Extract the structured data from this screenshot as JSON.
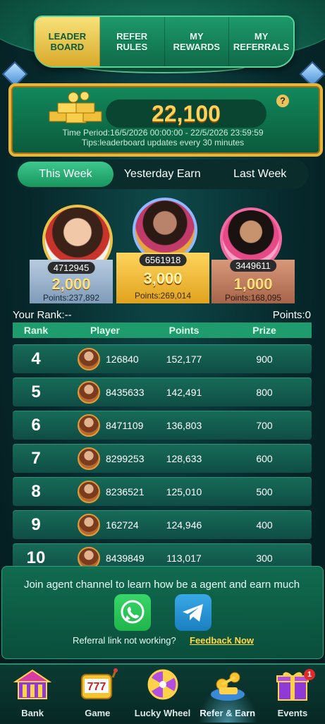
{
  "tabs": [
    {
      "label": "LEADER\nBOARD",
      "active": true
    },
    {
      "label": "REFER\nRULES",
      "active": false
    },
    {
      "label": "MY\nREWARDS",
      "active": false
    },
    {
      "label": "MY\nREFERRALS",
      "active": false
    }
  ],
  "prize_pool": {
    "amount": "22,100",
    "help_icon": "?",
    "time_period": "Time Period:16/5/2026 00:00:00 - 22/5/2026 23:59:59",
    "tips": "Tips:leaderboard updates every 30 minutes"
  },
  "week_tabs": [
    {
      "label": "This Week",
      "active": true
    },
    {
      "label": "Yesterday Earn",
      "active": false
    },
    {
      "label": "Last Week",
      "active": false
    }
  ],
  "podium": {
    "first": {
      "id": "6561918",
      "prize": "3,000",
      "points": "Points:269,014"
    },
    "second": {
      "id": "4712945",
      "prize": "2,000",
      "points": "Points:237,892"
    },
    "third": {
      "id": "3449611",
      "prize": "1,000",
      "points": "Points:168,095"
    }
  },
  "your_rank": "Your Rank:--",
  "your_points": "Points:0",
  "table_headers": {
    "rank": "Rank",
    "player": "Player",
    "points": "Points",
    "prize": "Prize"
  },
  "rows": [
    {
      "rank": "4",
      "player": "126840",
      "points": "152,177",
      "prize": "900"
    },
    {
      "rank": "5",
      "player": "8435633",
      "points": "142,491",
      "prize": "800"
    },
    {
      "rank": "6",
      "player": "8471109",
      "points": "136,803",
      "prize": "700"
    },
    {
      "rank": "7",
      "player": "8299253",
      "points": "128,633",
      "prize": "600"
    },
    {
      "rank": "8",
      "player": "8236521",
      "points": "125,010",
      "prize": "500"
    },
    {
      "rank": "9",
      "player": "162724",
      "points": "124,946",
      "prize": "400"
    },
    {
      "rank": "10",
      "player": "8439849",
      "points": "113,017",
      "prize": "300"
    }
  ],
  "agent": {
    "text": "Join agent channel to learn how be a agent and earn much",
    "referral_question": "Referral link not working?",
    "feedback_link": "Feedback Now",
    "whatsapp_icon": "whatsapp-icon",
    "telegram_icon": "telegram-icon"
  },
  "nav": [
    {
      "label": "Bank",
      "icon": "bank-icon",
      "active": false
    },
    {
      "label": "Game",
      "icon": "slot-777-icon",
      "active": false
    },
    {
      "label": "Lucky Wheel",
      "icon": "wheel-icon",
      "active": false
    },
    {
      "label": "Refer & Earn",
      "icon": "refer-earn-icon",
      "active": true
    },
    {
      "label": "Events",
      "icon": "gift-icon",
      "active": false,
      "badge": "1"
    }
  ],
  "colors": {
    "accent_gold": "#ffd35a",
    "panel_green": "#13895c",
    "active_tab": "#19955f"
  }
}
